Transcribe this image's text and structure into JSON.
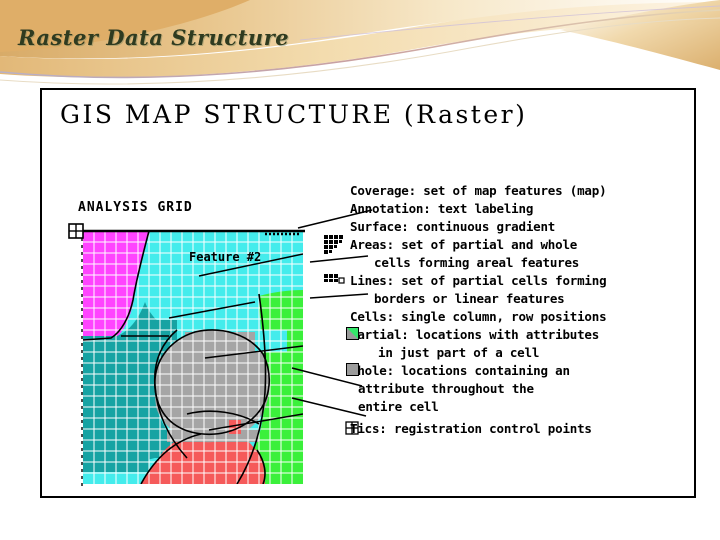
{
  "slide": {
    "title": "Raster Data Structure",
    "title_color": "#2f3b20",
    "background_color": "#ffffff",
    "accent_color": "#e8c88a"
  },
  "figure": {
    "title": "GIS MAP STRUCTURE  (Raster)",
    "grid_label": "ANALYSIS GRID",
    "feature_label": "Feature #2",
    "border_color": "#000000"
  },
  "legend": {
    "rows": [
      {
        "icon": "none",
        "term": "Coverage: set of map features (map)"
      },
      {
        "icon": "none",
        "term": "Annotation: text labeling"
      },
      {
        "icon": "none",
        "term": "Surface: continuous gradient"
      },
      {
        "icon": "areas",
        "term": "Areas: set of partial and whole"
      },
      {
        "icon": "none",
        "term": "cells forming areal features"
      },
      {
        "icon": "lines",
        "term": "Lines: set of partial cells forming"
      },
      {
        "icon": "none",
        "term": "borders or linear features"
      },
      {
        "icon": "none",
        "term": "Cells: single column, row positions"
      },
      {
        "icon": "partial",
        "term": "Partial: locations with attributes"
      },
      {
        "icon": "none",
        "term": "in just part of a cell"
      },
      {
        "icon": "whole",
        "term": "Whole: locations containing an"
      },
      {
        "icon": "none",
        "term": "attribute throughout the"
      },
      {
        "icon": "none",
        "term": "entire cell"
      },
      {
        "icon": "tics",
        "term": "Tics: registration control points"
      }
    ]
  },
  "grid": {
    "columns": 22,
    "rows": 24,
    "cell_size": 11,
    "gridline_color": "#ffffff",
    "region_colors": {
      "magenta": "#ff44ff",
      "cyan": "#44ecec",
      "teal": "#16a3a3",
      "gray": "#a5a5a5",
      "green": "#3bf03b",
      "red": "#f55a5a",
      "white": "#ffffff"
    },
    "region_names": [
      "magenta",
      "cyan",
      "teal",
      "gray",
      "green",
      "red"
    ],
    "tic_marker": "tic-cross"
  }
}
